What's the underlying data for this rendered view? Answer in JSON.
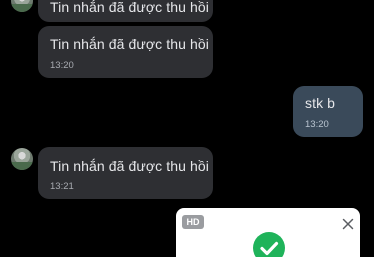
{
  "messages": [
    {
      "id": "m1",
      "direction": "incoming",
      "text": "Tin nhắn đã được thu hồi"
    },
    {
      "id": "m2",
      "direction": "incoming",
      "text": "Tin nhắn đã được thu hồi",
      "time": "13:20"
    },
    {
      "id": "m3",
      "direction": "outgoing",
      "text": "stk b",
      "time": "13:20"
    },
    {
      "id": "m4",
      "direction": "incoming",
      "text": "Tin nhắn đã được thu hồi",
      "time": "13:21"
    }
  ],
  "popup": {
    "badge": "HD",
    "close_icon": "close-icon",
    "status_icon": "check-circle-icon",
    "status_color": "#1fb35a"
  },
  "colors": {
    "background": "#000000",
    "incoming_bubble": "#2e2f33",
    "outgoing_bubble": "#3a4a5a"
  }
}
